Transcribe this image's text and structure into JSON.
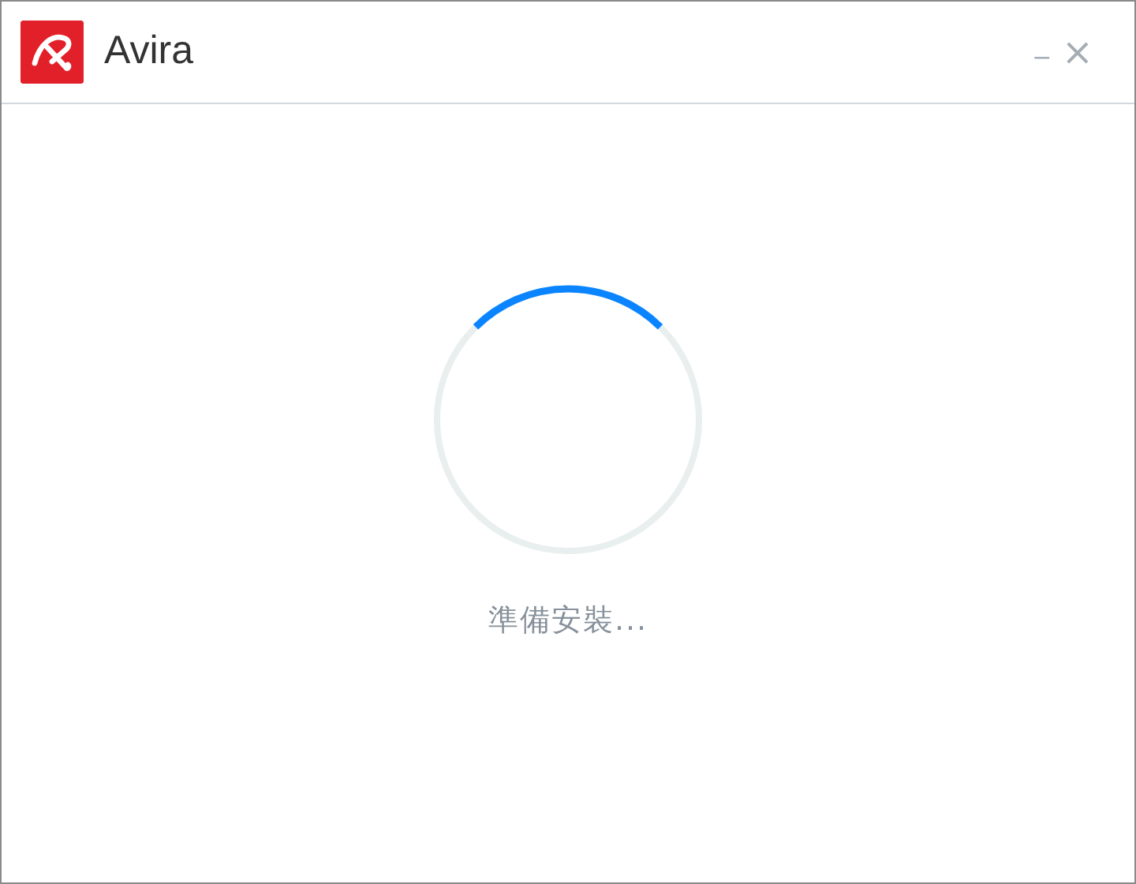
{
  "window": {
    "title": "Avira"
  },
  "title_bar_buttons": [
    {
      "kind": "minimize",
      "label": "_"
    },
    {
      "kind": "close",
      "label": "×"
    }
  ],
  "status": {
    "text": "準備安裝..."
  }
}
